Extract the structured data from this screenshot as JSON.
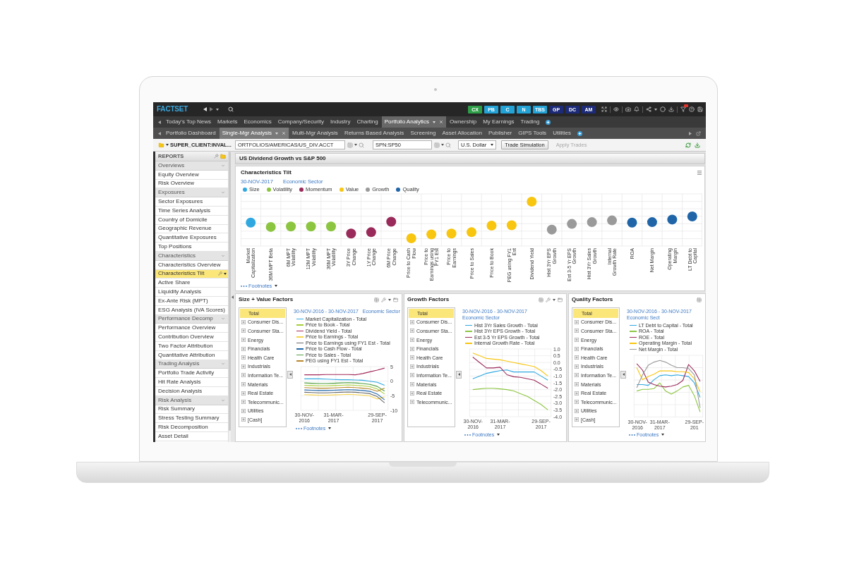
{
  "top_bar": {
    "logo": "FACTSET",
    "quick_buttons": [
      {
        "label": "CX",
        "color": "#2f9e48"
      },
      {
        "label": "PB",
        "color": "#23a2d6"
      },
      {
        "label": "C",
        "color": "#23a2d6"
      },
      {
        "label": "N",
        "color": "#23a2d6"
      },
      {
        "label": "TBS",
        "color": "#23a2d6"
      },
      {
        "label": "GP",
        "color": "#1c2a78"
      },
      {
        "label": "DC",
        "color": "#1c2a78"
      },
      {
        "label": "AM",
        "color": "#1c2a78"
      }
    ]
  },
  "app_tabs": [
    {
      "label": "Today's Top News",
      "selected": false
    },
    {
      "label": "Markets",
      "selected": false
    },
    {
      "label": "Economics",
      "selected": false
    },
    {
      "label": "Company/Security",
      "selected": false
    },
    {
      "label": "Industry",
      "selected": false
    },
    {
      "label": "Charting",
      "selected": false
    },
    {
      "label": "Portfolio Analytics",
      "selected": true
    },
    {
      "label": "Ownership",
      "selected": false
    },
    {
      "label": "My Earnings",
      "selected": false
    },
    {
      "label": "Trading",
      "selected": false
    }
  ],
  "sub_tabs": [
    {
      "label": "Portfolio Dashboard",
      "selected": false
    },
    {
      "label": "Single-Mgr Analysis",
      "selected": true
    },
    {
      "label": "Multi-Mgr Analysis",
      "selected": false
    },
    {
      "label": "Returns Based Analysis",
      "selected": false
    },
    {
      "label": "Screening",
      "selected": false
    },
    {
      "label": "Asset Allocation",
      "selected": false
    },
    {
      "label": "Publisher",
      "selected": false
    },
    {
      "label": "GIPS Tools",
      "selected": false
    },
    {
      "label": "Utilities",
      "selected": false
    }
  ],
  "toolbar": {
    "account": "SUPER_CLIENT:INVAL...",
    "portfolio_field": {
      "value": "ORTFOLIOS/AMERICAS/US_DIV.ACCT"
    },
    "benchmark_field": {
      "value": "SPN:SP50"
    },
    "currency": "U.S. Dollar",
    "buttons": [
      {
        "label": "Trade Simulation",
        "disabled": false
      },
      {
        "label": "Apply Trades",
        "disabled": true
      }
    ]
  },
  "sidebar": {
    "title": "REPORTS",
    "groups": [
      {
        "label": "Overviews",
        "expanded": true,
        "children": [
          {
            "label": "Equity Overview",
            "selected": false
          },
          {
            "label": "Risk Overview",
            "selected": false
          }
        ]
      },
      {
        "label": "Exposures",
        "expanded": true,
        "children": [
          {
            "label": "Sector Exposures",
            "selected": false
          },
          {
            "label": "Time Series Analysis",
            "selected": false
          },
          {
            "label": "Country of Domicile",
            "selected": false
          },
          {
            "label": "Geographic Revenue",
            "selected": false
          },
          {
            "label": "Quantitative Exposures",
            "selected": false
          },
          {
            "label": "Top Positions",
            "selected": false
          }
        ]
      },
      {
        "label": "Characteristics",
        "expanded": true,
        "children": [
          {
            "label": "Characteristics Overview",
            "selected": false
          },
          {
            "label": "Characteristics Tilt",
            "selected": true
          },
          {
            "label": "Active Share",
            "selected": false
          },
          {
            "label": "Liquidity Analysis",
            "selected": false
          },
          {
            "label": "Ex-Ante Risk (MPT)",
            "selected": false
          },
          {
            "label": "ESG Analysis (IVA Scores)",
            "selected": false
          }
        ]
      },
      {
        "label": "Performance Decomp",
        "expanded": true,
        "children": [
          {
            "label": "Performance Overview",
            "selected": false
          },
          {
            "label": "Contribution Overview",
            "selected": false
          },
          {
            "label": "Two Factor Attribution",
            "selected": false
          },
          {
            "label": "Quantitative Attribution",
            "selected": false
          }
        ]
      },
      {
        "label": "Trading Analysis",
        "expanded": true,
        "children": [
          {
            "label": "Portfolio Trade Activity",
            "selected": false
          },
          {
            "label": "Hit Rate Analysis",
            "selected": false
          },
          {
            "label": "Decision Analysis",
            "selected": false
          }
        ]
      },
      {
        "label": "Risk Analysis",
        "expanded": true,
        "children": [
          {
            "label": "Risk Summary",
            "selected": false
          },
          {
            "label": "Stress Testing Summary",
            "selected": false
          },
          {
            "label": "Risk Decomposition",
            "selected": false
          },
          {
            "label": "Asset Detail",
            "selected": false
          }
        ]
      }
    ]
  },
  "report_title": "US Dividend Growth vs S&P 500",
  "tilt_panel": {
    "title": "Characteristics Tilt",
    "date": "30-NOV-2017",
    "grouping": "Economic Sector",
    "legend": [
      {
        "label": "Size",
        "color": "#2fa8e0"
      },
      {
        "label": "Volatility",
        "color": "#8cc540"
      },
      {
        "label": "Momentum",
        "color": "#9a2a5a"
      },
      {
        "label": "Value",
        "color": "#f8c50f"
      },
      {
        "label": "Growth",
        "color": "#9a9a9a"
      },
      {
        "label": "Quality",
        "color": "#1f65a8"
      }
    ],
    "categories": [
      {
        "label": "Market Capitalization",
        "color": "#2fa8e0"
      },
      {
        "label": "36M MPT Beta",
        "color": "#8cc540"
      },
      {
        "label": "6M MPT Volatility",
        "color": "#8cc540"
      },
      {
        "label": "12M MPT Volatility",
        "color": "#8cc540"
      },
      {
        "label": "36M MPT Volatility",
        "color": "#8cc540"
      },
      {
        "label": "3Y Price Change",
        "color": "#9a2a5a"
      },
      {
        "label": "1Y Price Change",
        "color": "#9a2a5a"
      },
      {
        "label": "6M Price Change",
        "color": "#9a2a5a"
      },
      {
        "label": "Price to Cash Flow",
        "color": "#f8c50f"
      },
      {
        "label": "Price to Earnings using FY1 Est",
        "color": "#f8c50f"
      },
      {
        "label": "Price to Earnings",
        "color": "#f8c50f"
      },
      {
        "label": "Price to Sales",
        "color": "#f8c50f"
      },
      {
        "label": "Price to Book",
        "color": "#f8c50f"
      },
      {
        "label": "PEG using FY1 Est",
        "color": "#f8c50f"
      },
      {
        "label": "Dividend Yield",
        "color": "#f8c50f"
      },
      {
        "label": "Hist 3Yr EPS Growth",
        "color": "#9a9a9a"
      },
      {
        "label": "Est 3-5 Yr EPS Growth",
        "color": "#9a9a9a"
      },
      {
        "label": "Hist 3Yr Sales Growth",
        "color": "#9a9a9a"
      },
      {
        "label": "Internal Growth Rate",
        "color": "#9a9a9a"
      },
      {
        "label": "ROA",
        "color": "#1f65a8"
      },
      {
        "label": "Net Margin",
        "color": "#1f65a8"
      },
      {
        "label": "Operating Margin",
        "color": "#1f65a8"
      },
      {
        "label": "LT Debt to Capital",
        "color": "#1f65a8"
      }
    ],
    "footnotes": "Footnotes"
  },
  "factor_panels": [
    {
      "title": "Size + Value Factors",
      "list": [
        {
          "label": "Total",
          "selected": true,
          "expandable": false
        },
        {
          "label": "Consumer Dis...",
          "selected": false,
          "expandable": true
        },
        {
          "label": "Consumer Sta...",
          "selected": false,
          "expandable": true
        },
        {
          "label": "Energy",
          "selected": false,
          "expandable": true
        },
        {
          "label": "Financials",
          "selected": false,
          "expandable": true
        },
        {
          "label": "Health Care",
          "selected": false,
          "expandable": true
        },
        {
          "label": "Industrials",
          "selected": false,
          "expandable": true
        },
        {
          "label": "Information Te...",
          "selected": false,
          "expandable": true
        },
        {
          "label": "Materials",
          "selected": false,
          "expandable": true
        },
        {
          "label": "Real Estate",
          "selected": false,
          "expandable": true
        },
        {
          "label": "Telecommunic...",
          "selected": false,
          "expandable": true
        },
        {
          "label": "Utilities",
          "selected": false,
          "expandable": true
        },
        {
          "label": "[Cash]",
          "selected": false,
          "expandable": true
        }
      ],
      "date_range": "30-NOV-2016 - 30-NOV-2017",
      "grouping": "Economic Sector",
      "chart_data": {
        "type": "line",
        "grid": true,
        "categories": [
          "30-NOV-2016",
          null,
          null,
          null,
          "31-MAR-2017",
          null,
          null,
          null,
          null,
          null,
          "29-SEP-2017",
          null
        ],
        "ylim": [
          -10,
          5
        ],
        "yticks": [
          5,
          0,
          -5,
          -10
        ],
        "series": [
          {
            "name": "Market Capitalization - Total",
            "color": "#2fa8e0",
            "values": [
              0.8,
              0.8,
              0.8,
              0.7,
              0.6,
              0.5,
              0.5,
              0.4,
              0.3,
              0.0,
              -0.4,
              -1.4
            ]
          },
          {
            "name": "Price to Book - Total",
            "color": "#a6ce39",
            "values": [
              -1.4,
              -1.5,
              -1.6,
              -1.6,
              -1.5,
              -1.4,
              -1.3,
              -1.4,
              -1.6,
              -1.9,
              -2.7,
              -4.4
            ]
          },
          {
            "name": "Dividend Yield - Total",
            "color": "#a3285b",
            "values": [
              2.2,
              2.2,
              2.2,
              2.3,
              2.3,
              2.3,
              2.3,
              2.2,
              2.6,
              3.2,
              3.8,
              4.5
            ]
          },
          {
            "name": "Price to Earnings - Total",
            "color": "#f7d44a",
            "values": [
              -4.6,
              -4.7,
              -4.8,
              -4.8,
              -4.7,
              -4.6,
              -4.5,
              -4.6,
              -4.8,
              -5.1,
              -6.1,
              -5.4
            ]
          },
          {
            "name": "Price to Earnings using FY1 Est - Total",
            "color": "#666666",
            "values": [
              -3.8,
              -3.9,
              -4.0,
              -4.0,
              -3.9,
              -3.8,
              -3.7,
              -3.8,
              -4.0,
              -4.3,
              -5.3,
              -7.4
            ]
          },
          {
            "name": "Price to Cash Flow - Total",
            "color": "#1f65a8",
            "values": [
              -3.0,
              -3.1,
              -3.2,
              -3.2,
              -3.1,
              -3.0,
              -2.9,
              -3.0,
              -3.2,
              -3.5,
              -4.4,
              -6.4
            ]
          },
          {
            "name": "Price to Sales - Total",
            "color": "#4f9e3f",
            "values": [
              -0.6,
              -0.7,
              -0.8,
              -0.8,
              -0.7,
              -0.6,
              -0.5,
              -0.6,
              -0.8,
              -1.1,
              -1.8,
              -3.4
            ]
          },
          {
            "name": "PEG using FY1 Est - Total",
            "color": "#b8862b",
            "values": [
              -2.2,
              -2.3,
              -2.4,
              -2.4,
              -2.3,
              -2.2,
              -2.1,
              -2.2,
              -2.4,
              -2.7,
              -3.5,
              -2.4
            ]
          }
        ]
      },
      "footnotes": "Footnotes"
    },
    {
      "title": "Growth Factors",
      "list": [
        {
          "label": "Total",
          "selected": true,
          "expandable": false
        },
        {
          "label": "Consumer Dis...",
          "selected": false,
          "expandable": true
        },
        {
          "label": "Consumer Sta...",
          "selected": false,
          "expandable": true
        },
        {
          "label": "Energy",
          "selected": false,
          "expandable": true
        },
        {
          "label": "Financials",
          "selected": false,
          "expandable": true
        },
        {
          "label": "Health Care",
          "selected": false,
          "expandable": true
        },
        {
          "label": "Industrials",
          "selected": false,
          "expandable": true
        },
        {
          "label": "Information Te...",
          "selected": false,
          "expandable": true
        },
        {
          "label": "Materials",
          "selected": false,
          "expandable": true
        },
        {
          "label": "Real Estate",
          "selected": false,
          "expandable": true
        },
        {
          "label": "Telecommunic...",
          "selected": false,
          "expandable": true
        }
      ],
      "date_range": "30-NOV-2016 - 30-NOV-2017",
      "grouping": "Economic Sector",
      "chart_data": {
        "type": "line",
        "grid": true,
        "categories": [
          "30-NOV-2016",
          null,
          null,
          null,
          "31-MAR-2017",
          null,
          null,
          null,
          null,
          null,
          "29-SEP-2017",
          null
        ],
        "ylim": [
          -4,
          1
        ],
        "yticks": [
          {
            "value": 1,
            "label": "1.0"
          },
          {
            "value": 0.5,
            "label": "0.5"
          },
          {
            "value": 0,
            "label": "0.0"
          },
          {
            "value": -0.5,
            "label": "-0.5"
          },
          {
            "value": -1,
            "label": "-1.0"
          },
          {
            "value": -1.5,
            "label": "-1.5"
          },
          {
            "value": -2,
            "label": "-2.0"
          },
          {
            "value": -2.5,
            "label": "-2.5"
          },
          {
            "value": -3,
            "label": "-3.0"
          },
          {
            "value": -3.5,
            "label": "-3.5"
          },
          {
            "value": -4,
            "label": "-4.0"
          }
        ],
        "series": [
          {
            "name": "Hist 3Yr Sales Growth - Total",
            "color": "#2fa8e0",
            "values": [
              -1.2,
              -1.0,
              -0.8,
              -0.7,
              -0.6,
              -0.55,
              -0.7,
              -0.7,
              -0.7,
              -0.7,
              -1.0,
              -1.3
            ]
          },
          {
            "name": "Hist 3Yr EPS Growth - Total",
            "color": "#8cc540",
            "values": [
              -2.0,
              -1.95,
              -1.9,
              -1.9,
              -1.95,
              -2.0,
              -2.1,
              -2.3,
              -2.5,
              -2.8,
              -3.1,
              -3.5
            ]
          },
          {
            "name": "Est 3-5 Yr EPS Growth - Total",
            "color": "#9a2a5a",
            "values": [
              0.4,
              0.0,
              -0.4,
              -0.4,
              -0.35,
              -0.9,
              -1.05,
              -1.1,
              -1.2,
              -1.3,
              -1.6,
              -1.9
            ]
          },
          {
            "name": "Internal Growth Rate - Total",
            "color": "#f8c50f",
            "values": [
              0.7,
              0.5,
              0.3,
              0.25,
              0.2,
              0.1,
              0.0,
              -0.1,
              -0.2,
              -0.3,
              -0.6,
              -1.0
            ]
          }
        ]
      },
      "footnotes": "Footnotes"
    },
    {
      "title": "Quality Factors",
      "list": [
        {
          "label": "Total",
          "selected": true,
          "expandable": false
        },
        {
          "label": "Consumer Dis...",
          "selected": false,
          "expandable": true
        },
        {
          "label": "Consumer Sta...",
          "selected": false,
          "expandable": true
        },
        {
          "label": "Energy",
          "selected": false,
          "expandable": true
        },
        {
          "label": "Financials",
          "selected": false,
          "expandable": true
        },
        {
          "label": "Health Care",
          "selected": false,
          "expandable": true
        },
        {
          "label": "Industrials",
          "selected": false,
          "expandable": true
        },
        {
          "label": "Information Te...",
          "selected": false,
          "expandable": true
        },
        {
          "label": "Materials",
          "selected": false,
          "expandable": true
        },
        {
          "label": "Real Estate",
          "selected": false,
          "expandable": true
        },
        {
          "label": "Telecommunic...",
          "selected": false,
          "expandable": true
        },
        {
          "label": "Utilities",
          "selected": false,
          "expandable": true
        },
        {
          "label": "[Cash]",
          "selected": false,
          "expandable": true
        }
      ],
      "date_range": "30-NOV-2016 - 30-NOV-2017",
      "grouping": "Economic Sect",
      "legend": [
        {
          "label": "LT Debt to Capital - Total",
          "color": "#2fa8e0"
        },
        {
          "label": "ROA - Total",
          "color": "#8cc540"
        },
        {
          "label": "ROE - Total",
          "color": "#9a2a5a"
        },
        {
          "label": "Operating Margin - Total",
          "color": "#f8c50f"
        },
        {
          "label": "Net Margin - Total",
          "color": "#9a9a9a"
        }
      ],
      "x_labels": [
        "30-NOV-2016",
        "31-MAR-2017",
        "29-SEP-201"
      ],
      "footnotes": "Footnotes"
    }
  ]
}
